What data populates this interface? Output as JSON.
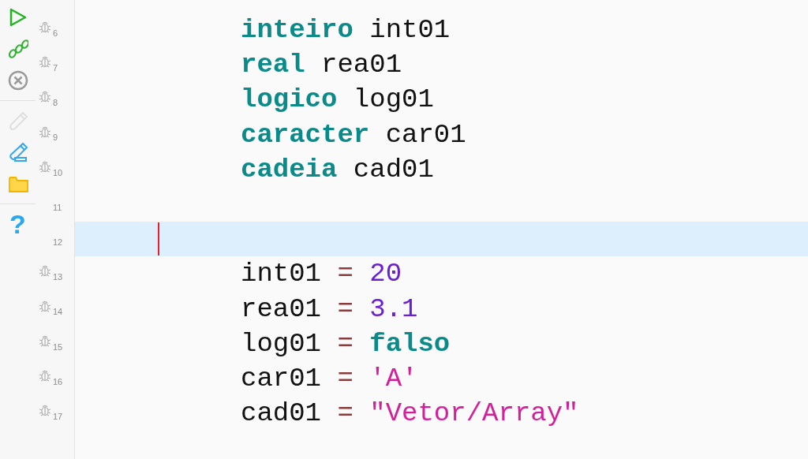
{
  "toolbar": [
    {
      "kind": "run",
      "disabled": false
    },
    {
      "kind": "step",
      "disabled": false
    },
    {
      "kind": "stop",
      "disabled": false
    },
    {
      "kind": "separator"
    },
    {
      "kind": "usb",
      "disabled": true
    },
    {
      "kind": "usb_edit",
      "disabled": false
    },
    {
      "kind": "folder",
      "disabled": false
    },
    {
      "kind": "separator"
    },
    {
      "kind": "help",
      "glyph": "?",
      "disabled": false
    }
  ],
  "lines": [
    {
      "number": "6",
      "debug_marker": true,
      "current": false,
      "caret": false,
      "tokens": [
        {
          "kind": "keyword",
          "text": "inteiro"
        },
        {
          "kind": "ident",
          "text": "int01"
        }
      ]
    },
    {
      "number": "7",
      "debug_marker": true,
      "current": false,
      "caret": false,
      "tokens": [
        {
          "kind": "keyword",
          "text": "real"
        },
        {
          "kind": "ident",
          "text": "rea01"
        }
      ]
    },
    {
      "number": "8",
      "debug_marker": true,
      "current": false,
      "caret": false,
      "tokens": [
        {
          "kind": "keyword",
          "text": "logico"
        },
        {
          "kind": "ident",
          "text": "log01"
        }
      ]
    },
    {
      "number": "9",
      "debug_marker": true,
      "current": false,
      "caret": false,
      "tokens": [
        {
          "kind": "keyword",
          "text": "caracter"
        },
        {
          "kind": "ident",
          "text": "car01"
        }
      ]
    },
    {
      "number": "10",
      "debug_marker": true,
      "current": false,
      "caret": false,
      "tokens": [
        {
          "kind": "keyword",
          "text": "cadeia"
        },
        {
          "kind": "ident",
          "text": "cad01"
        }
      ]
    },
    {
      "number": "11",
      "debug_marker": false,
      "current": false,
      "caret": false
    },
    {
      "number": "12",
      "debug_marker": false,
      "current": true,
      "caret": true
    },
    {
      "number": "13",
      "debug_marker": true,
      "current": false,
      "caret": false,
      "tokens": [
        {
          "kind": "ident",
          "text": "int01"
        },
        {
          "kind": "operator",
          "text": "="
        },
        {
          "kind": "number",
          "text": "20"
        }
      ]
    },
    {
      "number": "14",
      "debug_marker": true,
      "current": false,
      "caret": false,
      "tokens": [
        {
          "kind": "ident",
          "text": "rea01"
        },
        {
          "kind": "operator",
          "text": "="
        },
        {
          "kind": "number",
          "text": "3.1"
        }
      ]
    },
    {
      "number": "15",
      "debug_marker": true,
      "current": false,
      "caret": false,
      "tokens": [
        {
          "kind": "ident",
          "text": "log01"
        },
        {
          "kind": "operator",
          "text": "="
        },
        {
          "kind": "keyword",
          "text": "falso"
        }
      ]
    },
    {
      "number": "16",
      "debug_marker": true,
      "current": false,
      "caret": false,
      "tokens": [
        {
          "kind": "ident",
          "text": "car01"
        },
        {
          "kind": "operator",
          "text": "="
        },
        {
          "kind": "string",
          "text": "'A'"
        }
      ]
    },
    {
      "number": "17",
      "debug_marker": true,
      "current": false,
      "caret": false,
      "tokens": [
        {
          "kind": "ident",
          "text": "cad01"
        },
        {
          "kind": "operator",
          "text": "="
        },
        {
          "kind": "string",
          "text": "\"Vetor/Array\""
        }
      ]
    }
  ]
}
